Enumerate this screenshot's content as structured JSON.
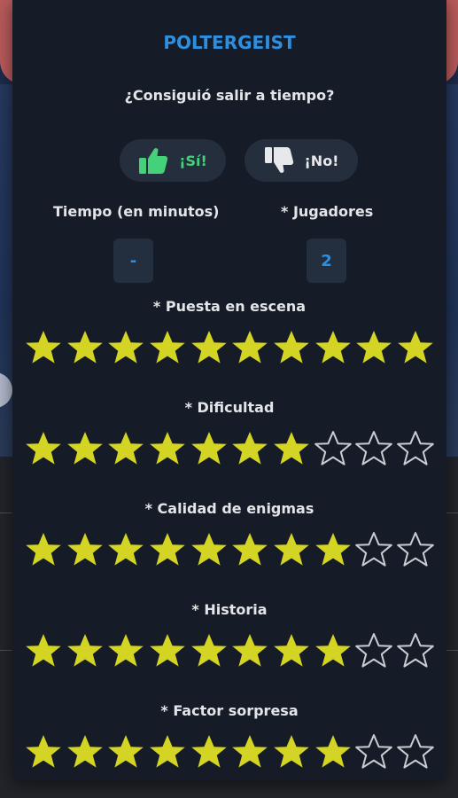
{
  "dialog": {
    "title": "POLTERGEIST",
    "question": "¿Consiguió salir a tiempo?",
    "yes_label": "¡Sí!",
    "no_label": "¡No!"
  },
  "fields": {
    "time_label": "Tiempo (en minutos)",
    "time_value": "-",
    "players_label": "* Jugadores",
    "players_value": "2"
  },
  "ratings": [
    {
      "label": "* Puesta en escena",
      "value": 10,
      "max": 10
    },
    {
      "label": "* Dificultad",
      "value": 7,
      "max": 10
    },
    {
      "label": "* Calidad de enigmas",
      "value": 8,
      "max": 10
    },
    {
      "label": "* Historia",
      "value": 8,
      "max": 10
    },
    {
      "label": "* Factor sorpresa",
      "value": 8,
      "max": 10
    }
  ],
  "colors": {
    "accent": "#2d8fe0",
    "yes": "#44d17a",
    "star_filled": "#d4d424",
    "star_empty_stroke": "#c9ccd1",
    "panel": "#161c27"
  },
  "icons": {
    "yes": "thumbs-up-icon",
    "no": "thumbs-down-icon",
    "star": "star-icon"
  }
}
